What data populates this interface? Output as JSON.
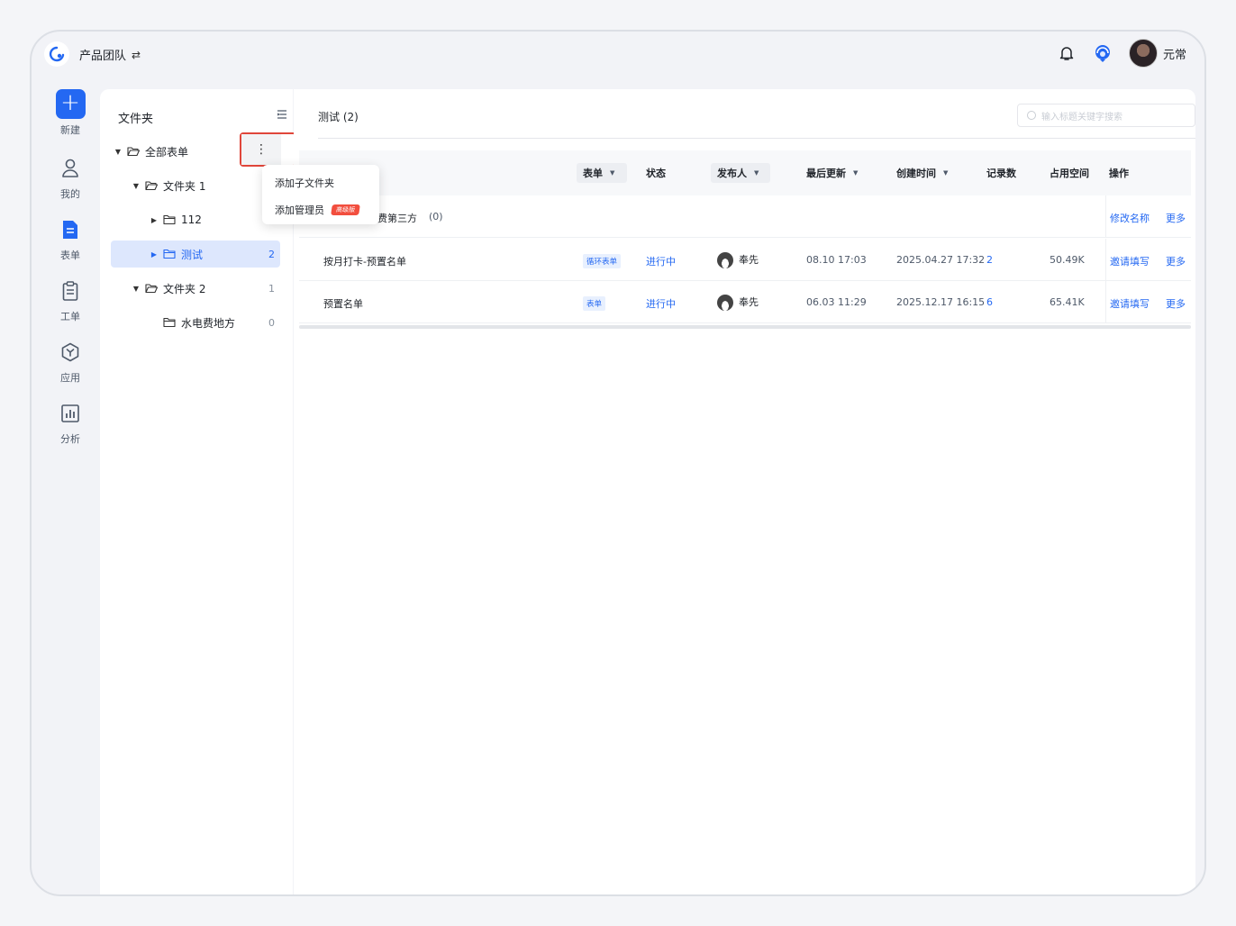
{
  "header": {
    "team_name": "产品团队",
    "switch_icon": "swap-icon",
    "user_name": "元常"
  },
  "nav": {
    "items": [
      {
        "label": "新建",
        "icon": "plus-icon"
      },
      {
        "label": "我的",
        "icon": "user-icon"
      },
      {
        "label": "表单",
        "icon": "form-doc-icon"
      },
      {
        "label": "工单",
        "icon": "clipboard-icon"
      },
      {
        "label": "应用",
        "icon": "hexagon-app-icon"
      },
      {
        "label": "分析",
        "icon": "bar-chart-icon"
      }
    ]
  },
  "folder_panel": {
    "title": "文件夹",
    "tree": [
      {
        "label": "全部表单",
        "count": ""
      },
      {
        "label": "文件夹 1",
        "count": ""
      },
      {
        "label": "112",
        "count": ""
      },
      {
        "label": "测试",
        "count": "2"
      },
      {
        "label": "文件夹 2",
        "count": "1"
      },
      {
        "label": "水电费地方",
        "count": "0"
      }
    ],
    "more_menu": {
      "items": [
        {
          "label": "添加子文件夹"
        },
        {
          "label": "添加管理员",
          "badge": "高级版"
        }
      ]
    }
  },
  "main": {
    "title": "测试  (2)",
    "search_placeholder": "输入标题关键字搜索",
    "columns": {
      "form": "表单",
      "status": "状态",
      "publisher": "发布人",
      "last_update": "最后更新",
      "created": "创建时间",
      "records": "记录数",
      "space": "占用空间",
      "ops": "操作"
    },
    "folder_row": {
      "name": "费第三方",
      "count": "(0)",
      "op1": "修改名称",
      "op2": "更多"
    },
    "rows": [
      {
        "name": "按月打卡-预置名单",
        "type": "循环表单",
        "status": "进行中",
        "publisher": "奉先",
        "last_update": "08.10 17:03",
        "created": "2025.04.27 17:32",
        "records": "2",
        "space": "50.49K",
        "op1": "邀请填写",
        "op2": "更多"
      },
      {
        "name": "预置名单",
        "type": "表单",
        "status": "进行中",
        "publisher": "奉先",
        "last_update": "06.03 11:29",
        "created": "2025.12.17 16:15",
        "records": "6",
        "space": "65.41K",
        "op1": "邀请填写",
        "op2": "更多"
      }
    ]
  },
  "colors": {
    "accent": "#2468f2",
    "highlight_border": "#e0463a",
    "badge": "#f24e3e",
    "folder": "#f6b04f"
  }
}
